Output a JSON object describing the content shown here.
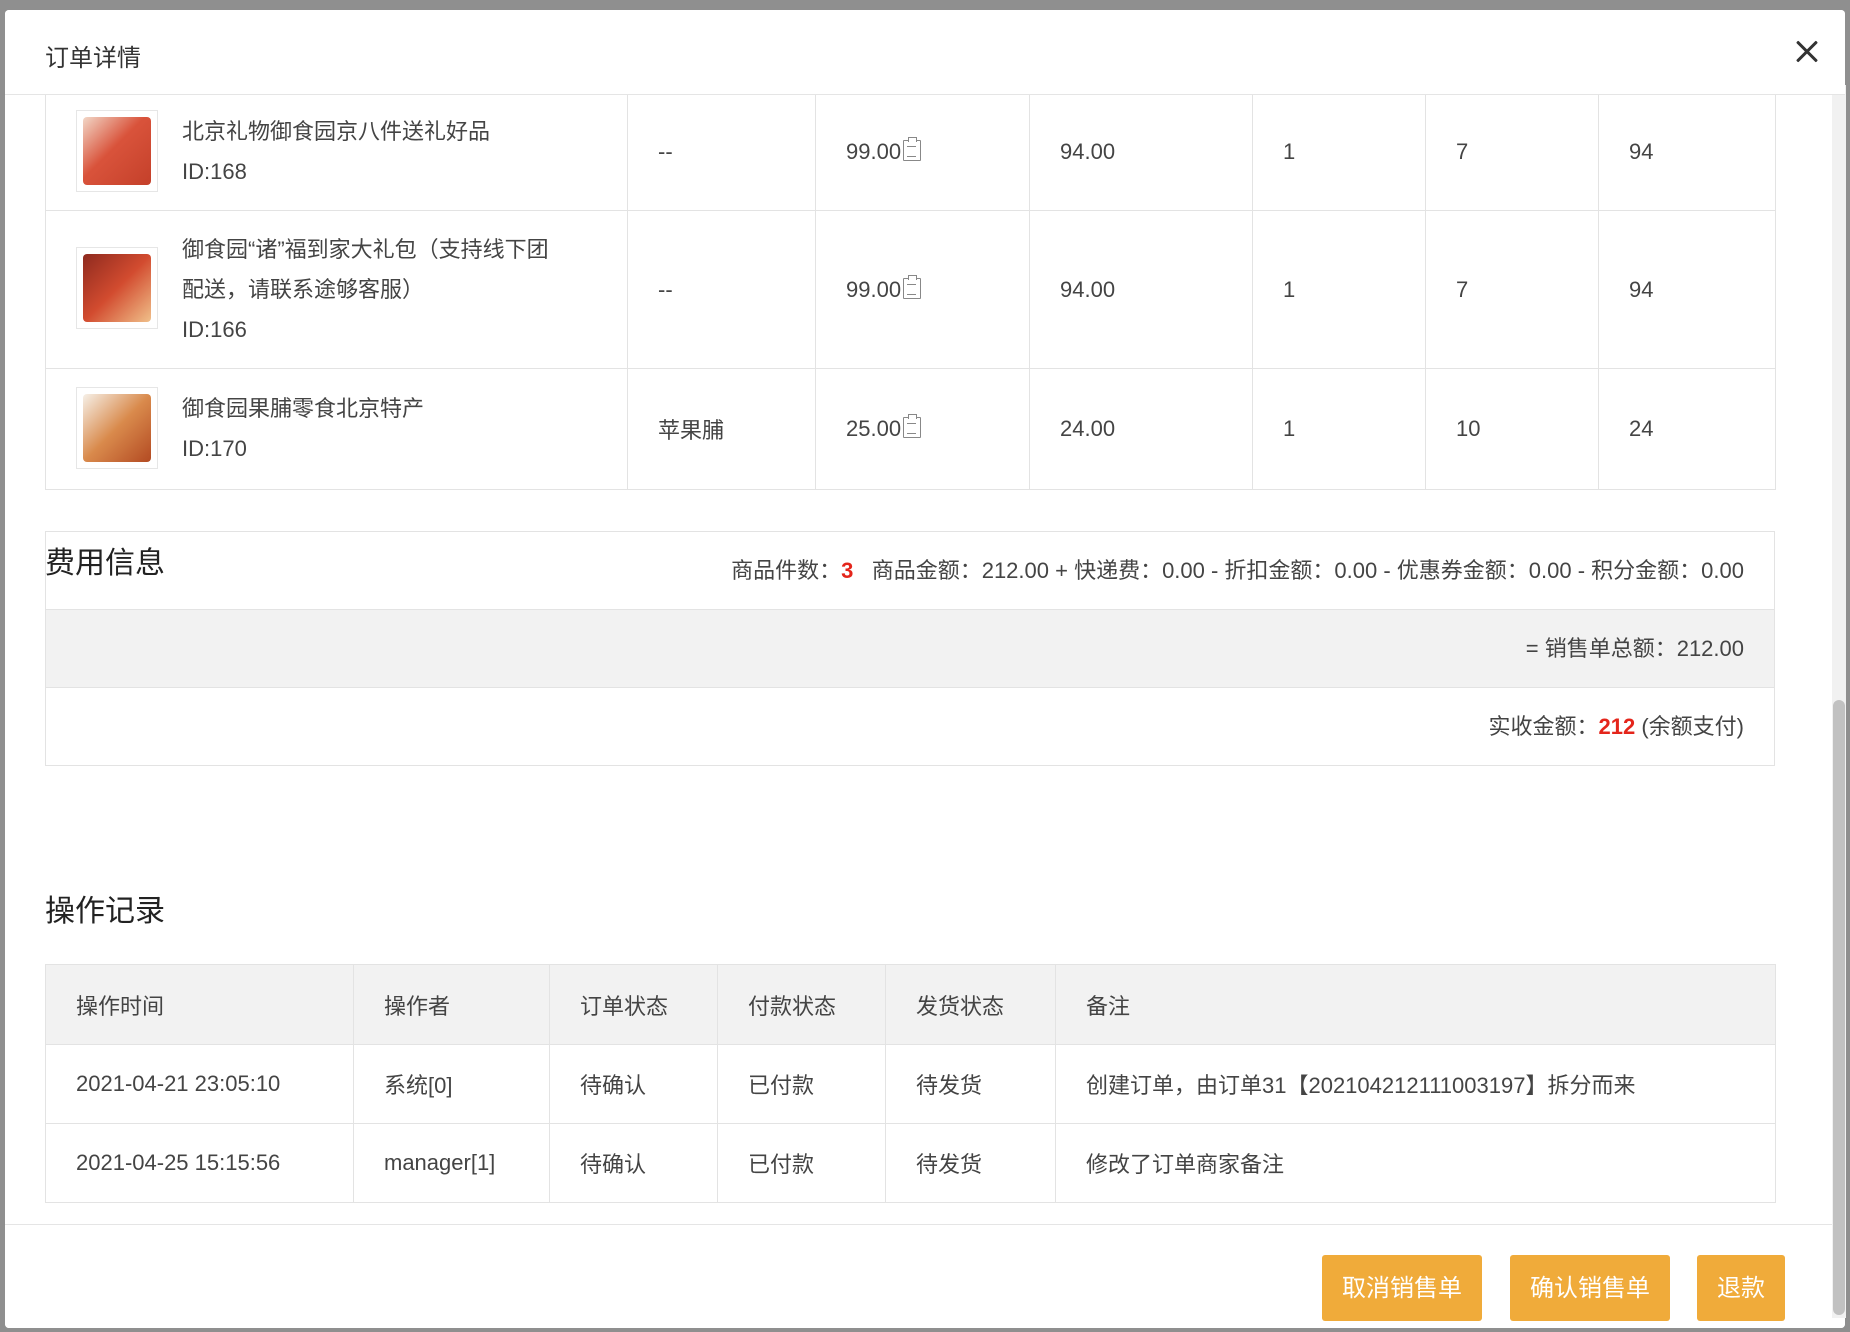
{
  "dialog": {
    "title": "订单详情"
  },
  "products": [
    {
      "name_lines": [
        "北京礼物御食园京八件送礼好品"
      ],
      "id": "ID:168",
      "spec": "--",
      "price": "99.00",
      "actual_price": "94.00",
      "qty": "1",
      "stock": "7",
      "subtotal": "94"
    },
    {
      "name_lines": [
        "御食园“诸”福到家大礼包（支持线下团",
        "配送，请联系途够客服）"
      ],
      "id": "ID:166",
      "spec": "--",
      "price": "99.00",
      "actual_price": "94.00",
      "qty": "1",
      "stock": "7",
      "subtotal": "94"
    },
    {
      "name_lines": [
        "御食园果脯零食北京特产"
      ],
      "id": "ID:170",
      "spec": "苹果脯",
      "price": "25.00",
      "actual_price": "24.00",
      "qty": "1",
      "stock": "10",
      "subtotal": "24"
    }
  ],
  "fee": {
    "section_title": "费用信息",
    "count_label": "商品件数：",
    "count_value": "3",
    "breakdown": "商品金额：212.00 + 快递费：0.00 - 折扣金额：0.00 - 优惠券金额：0.00 - 积分金额：0.00",
    "total": "= 销售单总额：212.00",
    "received_label": "实收金额：",
    "received_value": "212",
    "received_note": " (余额支付)"
  },
  "log": {
    "section_title": "操作记录",
    "headers": [
      "操作时间",
      "操作者",
      "订单状态",
      "付款状态",
      "发货状态",
      "备注"
    ],
    "rows": [
      [
        "2021-04-21 23:05:10",
        "系统[0]",
        "待确认",
        "已付款",
        "待发货",
        "创建订单，由订单31【202104212111003197】拆分而来"
      ],
      [
        "2021-04-25 15:15:56",
        "manager[1]",
        "待确认",
        "已付款",
        "待发货",
        "修改了订单商家备注"
      ]
    ]
  },
  "footer": {
    "cancel_label": "取消销售单",
    "confirm_label": "确认销售单",
    "refund_label": "退款"
  },
  "colors": {
    "accent": "#f0ab3a",
    "highlight": "#e4251b"
  },
  "icons": {
    "close": "close-icon",
    "copy": "copy-icon"
  }
}
